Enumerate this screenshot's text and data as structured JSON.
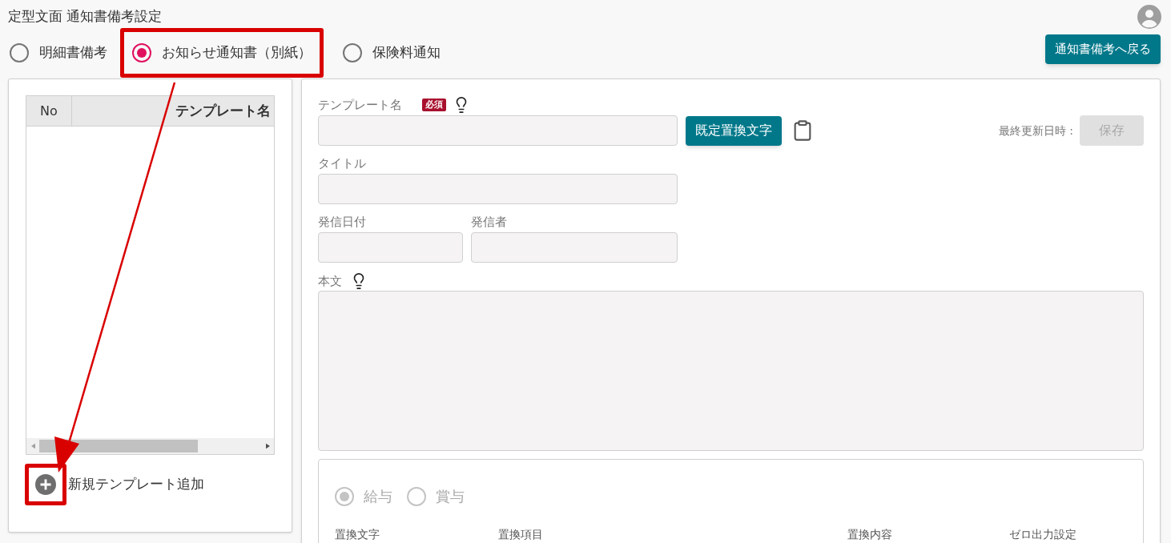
{
  "page_title": "定型文面 通知書備考設定",
  "doc_types": [
    {
      "label": "明細書備考",
      "selected": false,
      "highlighted": false
    },
    {
      "label": "お知らせ通知書（別紙）",
      "selected": true,
      "highlighted": true
    },
    {
      "label": "保険料通知",
      "selected": false,
      "highlighted": false
    }
  ],
  "back_button": "通知書備考へ戻る",
  "template_list": {
    "columns": [
      "No",
      "テンプレート名"
    ],
    "add_label": "新規テンプレート追加",
    "add_highlighted": true
  },
  "annotation_arrow": true,
  "form": {
    "template_name_label": "テンプレート名",
    "required_badge": "必須",
    "replace_button": "既定置換文字",
    "last_updated_label": "最終更新日時 :",
    "save_button": {
      "label": "保存",
      "disabled": true
    },
    "title_label": "タイトル",
    "date_label": "発信日付",
    "sender_label": "発信者",
    "body_label": "本文"
  },
  "replacement": {
    "disabled": true,
    "pay_types": [
      {
        "label": "給与",
        "selected": true
      },
      {
        "label": "賞与",
        "selected": false
      }
    ],
    "columns": [
      "置換文字",
      "置換項目",
      "置換内容",
      "ゼロ出力設定"
    ]
  }
}
